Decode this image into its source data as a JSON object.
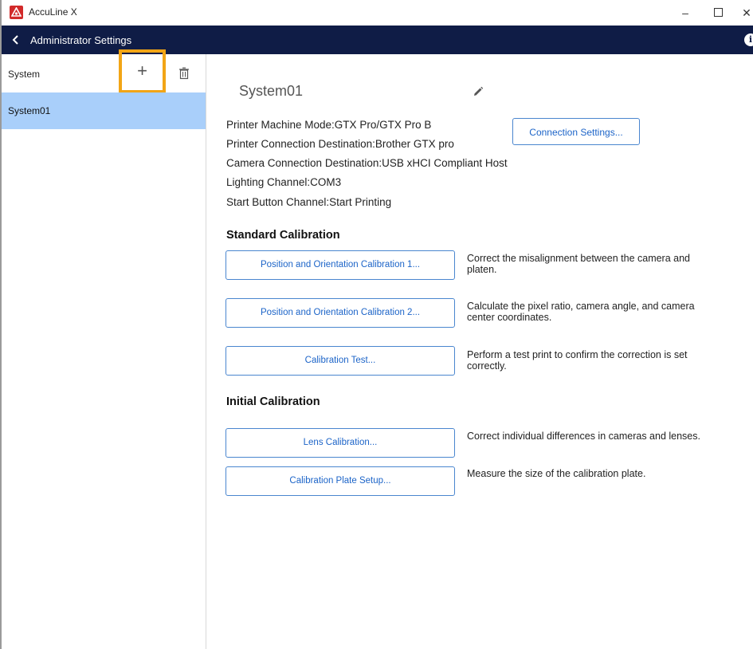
{
  "window": {
    "title": "AccuLine X",
    "minimize": "–",
    "close": "✕"
  },
  "header": {
    "title": "Administrator Settings",
    "info": "i"
  },
  "sidebar": {
    "label": "System",
    "add": "+",
    "items": [
      {
        "label": "System01",
        "selected": true
      }
    ]
  },
  "main": {
    "system_name": "System01",
    "info_lines": [
      "Printer Machine Mode:GTX Pro/GTX Pro B",
      "Printer Connection Destination:Brother GTX pro",
      "Camera Connection Destination:USB xHCI Compliant Host",
      "Lighting Channel:COM3",
      "Start Button Channel:Start Printing"
    ],
    "connection_settings": "Connection Settings...",
    "standard_title": "Standard Calibration",
    "initial_title": "Initial Calibration",
    "calibrations": [
      {
        "button": "Position and Orientation Calibration 1...",
        "description": "Correct the misalignment between the camera and platen."
      },
      {
        "button": "Position and Orientation Calibration 2...",
        "description": "Calculate the pixel ratio, camera angle, and camera center coordinates."
      },
      {
        "button": "Calibration Test...",
        "description": "Perform a test print to confirm the correction is set correctly."
      },
      {
        "button": "Lens Calibration...",
        "description": "Correct individual differences in cameras and lenses."
      },
      {
        "button": "Calibration Plate Setup...",
        "description": "Measure the size of the calibration plate."
      }
    ]
  },
  "colors": {
    "header_bg": "#0f1c46",
    "selected_item": "#a9cffa",
    "highlight": "#f2a516",
    "button_text": "#1c64c8"
  }
}
